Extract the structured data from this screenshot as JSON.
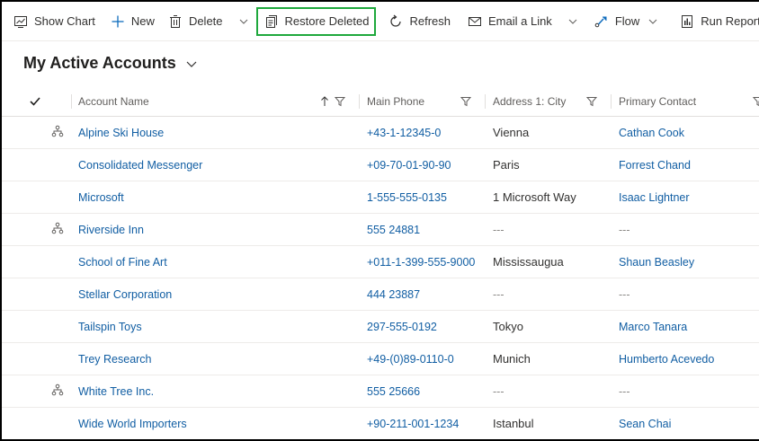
{
  "commands": {
    "show_chart": "Show Chart",
    "new": "New",
    "delete": "Delete",
    "restore_deleted": "Restore Deleted",
    "refresh": "Refresh",
    "email_link": "Email a Link",
    "flow": "Flow",
    "run_report": "Run Report"
  },
  "view": {
    "title": "My Active Accounts"
  },
  "columns": {
    "account_name": "Account Name",
    "main_phone": "Main Phone",
    "city": "Address 1: City",
    "primary_contact": "Primary Contact"
  },
  "rows": [
    {
      "name": "Alpine Ski House",
      "phone": "+43-1-12345-0",
      "city": "Vienna",
      "contact": "Cathan Cook",
      "hier": true
    },
    {
      "name": "Consolidated Messenger",
      "phone": "+09-70-01-90-90",
      "city": "Paris",
      "contact": "Forrest Chand",
      "hier": false
    },
    {
      "name": "Microsoft",
      "phone": "1-555-555-0135",
      "city": "1 Microsoft Way",
      "contact": "Isaac Lightner",
      "hier": false
    },
    {
      "name": "Riverside Inn",
      "phone": "555 24881",
      "city": "---",
      "contact": "---",
      "hier": true
    },
    {
      "name": "School of Fine Art",
      "phone": "+011-1-399-555-9000",
      "city": "Mississaugua",
      "contact": "Shaun Beasley",
      "hier": false
    },
    {
      "name": "Stellar Corporation",
      "phone": "444 23887",
      "city": "---",
      "contact": "---",
      "hier": false
    },
    {
      "name": "Tailspin Toys",
      "phone": "297-555-0192",
      "city": "Tokyo",
      "contact": "Marco Tanara",
      "hier": false
    },
    {
      "name": "Trey Research",
      "phone": "+49-(0)89-0110-0",
      "city": "Munich",
      "contact": "Humberto Acevedo",
      "hier": false
    },
    {
      "name": "White Tree Inc.",
      "phone": "555 25666",
      "city": "---",
      "contact": "---",
      "hier": true
    },
    {
      "name": "Wide World Importers",
      "phone": "+90-211-001-1234",
      "city": "Istanbul",
      "contact": "Sean Chai",
      "hier": false
    }
  ],
  "colors": {
    "link": "#115ea3",
    "highlight": "#1ea83c"
  },
  "icons": [
    "chart-icon",
    "plus-icon",
    "trash-icon",
    "restore-icon",
    "refresh-icon",
    "email-icon",
    "flow-icon",
    "report-icon",
    "chevron-down-icon",
    "checkmark-icon",
    "sort-up-icon",
    "filter-icon",
    "hierarchy-icon"
  ]
}
